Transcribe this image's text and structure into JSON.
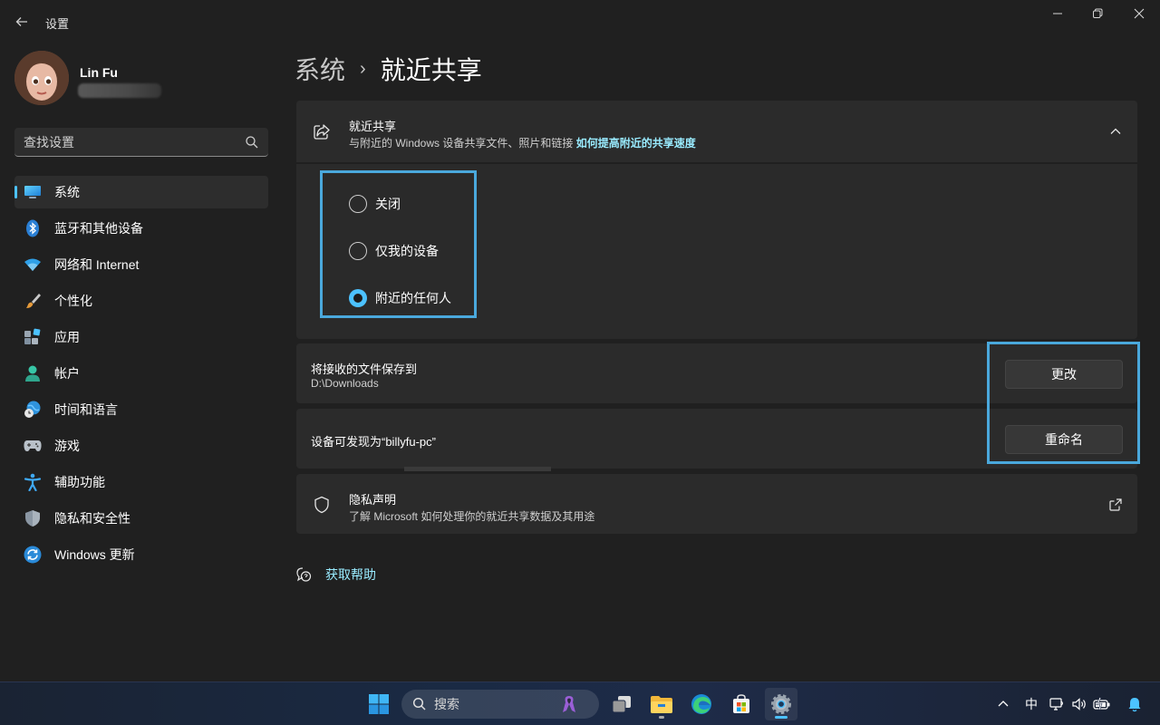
{
  "window": {
    "title": "设置",
    "back_icon": "back-arrow-icon",
    "controls": [
      "minimize-icon",
      "restore-icon",
      "close-icon"
    ]
  },
  "profile": {
    "name": "Lin Fu"
  },
  "search": {
    "placeholder": "查找设置"
  },
  "sidebar": {
    "items": [
      {
        "label": "系统",
        "icon": "system-display-icon",
        "active": true
      },
      {
        "label": "蓝牙和其他设备",
        "icon": "bluetooth-icon"
      },
      {
        "label": "网络和 Internet",
        "icon": "wifi-icon"
      },
      {
        "label": "个性化",
        "icon": "paintbrush-icon"
      },
      {
        "label": "应用",
        "icon": "apps-icon"
      },
      {
        "label": "帐户",
        "icon": "account-icon"
      },
      {
        "label": "时间和语言",
        "icon": "globe-clock-icon"
      },
      {
        "label": "游戏",
        "icon": "gamepad-icon"
      },
      {
        "label": "辅助功能",
        "icon": "accessibility-icon"
      },
      {
        "label": "隐私和安全性",
        "icon": "shield-icon"
      },
      {
        "label": "Windows 更新",
        "icon": "windows-update-icon"
      }
    ]
  },
  "breadcrumb": {
    "parent": "系统",
    "separator": "›",
    "current": "就近共享"
  },
  "nearby_sharing": {
    "title": "就近共享",
    "subtitle": "与附近的 Windows 设备共享文件、照片和链接",
    "link": "如何提高附近的共享速度",
    "options": [
      {
        "label": "关闭",
        "checked": false
      },
      {
        "label": "仅我的设备",
        "checked": false
      },
      {
        "label": "附近的任何人",
        "checked": true
      }
    ]
  },
  "save_location": {
    "title": "将接收的文件保存到",
    "path": "D:\\Downloads",
    "button": "更改"
  },
  "device_name": {
    "title": "设备可发现为“billyfu-pc”",
    "button": "重命名"
  },
  "privacy": {
    "title": "隐私声明",
    "subtitle": "了解 Microsoft 如何处理你的就近共享数据及其用途"
  },
  "help": {
    "label": "获取帮助"
  },
  "taskbar": {
    "search_label": "搜索",
    "ime": "中",
    "apps": [
      "start-icon",
      "task-view-icon",
      "file-explorer-icon",
      "edge-icon",
      "store-icon",
      "settings-icon"
    ]
  },
  "colors": {
    "accent": "#4cc2ff",
    "link": "#99ebff",
    "highlight_box": "#4aa8dc",
    "background": "#202020",
    "card": "#2b2b2b"
  }
}
